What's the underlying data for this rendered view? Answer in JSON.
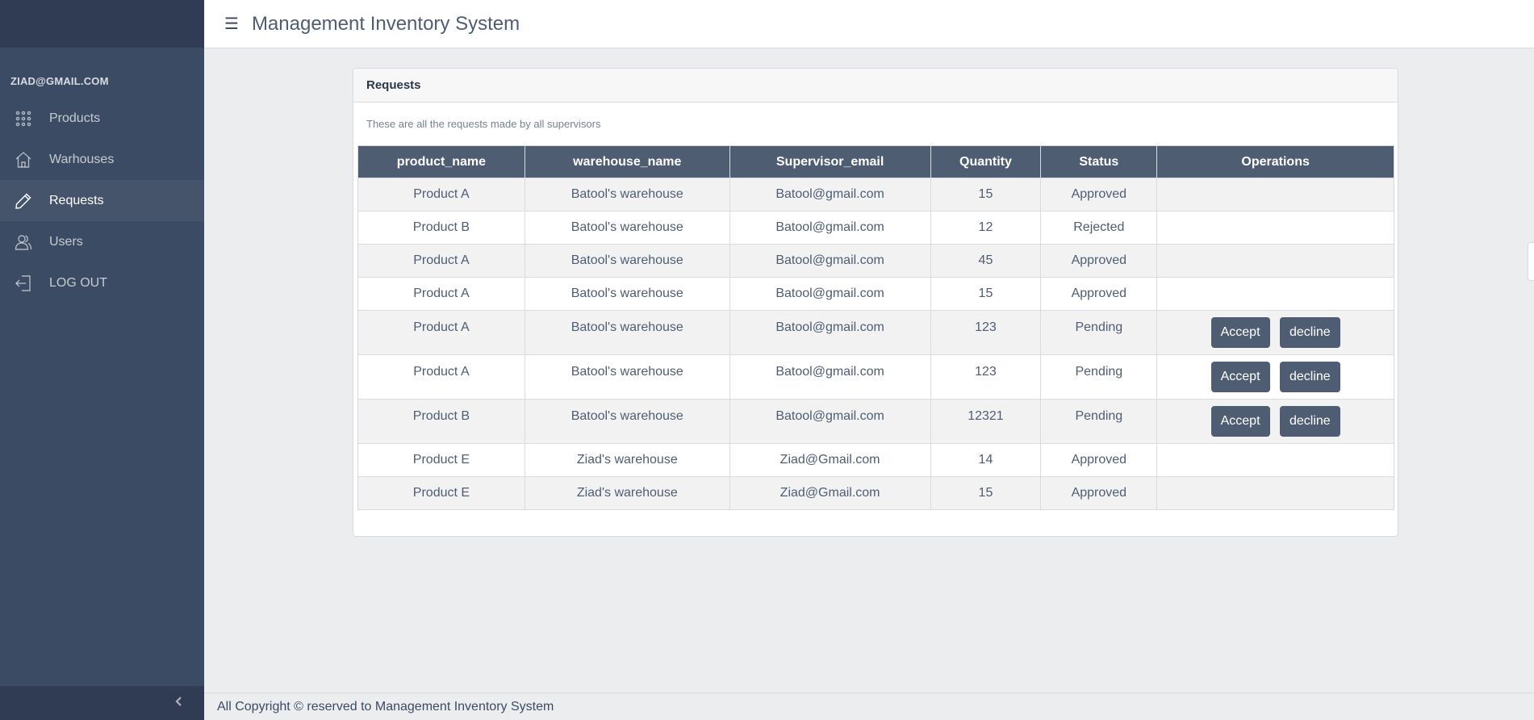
{
  "header": {
    "menu_icon": "hamburger-icon",
    "title": "Management Inventory System"
  },
  "sidebar": {
    "user_email": "ZIAD@GMAIL.COM",
    "items": [
      {
        "label": "Products",
        "icon": "grid-icon",
        "active": false
      },
      {
        "label": "Warhouses",
        "icon": "home-icon",
        "active": false
      },
      {
        "label": "Requests",
        "icon": "pencil-icon",
        "active": true
      },
      {
        "label": "Users",
        "icon": "users-icon",
        "active": false
      },
      {
        "label": "LOG OUT",
        "icon": "logout-icon",
        "active": false
      }
    ],
    "toggler_icon": "chevron-left-icon"
  },
  "card": {
    "title": "Requests",
    "description": "These are all the requests made by all supervisors",
    "columns": [
      "product_name",
      "warehouse_name",
      "Supervisor_email",
      "Quantity",
      "Status",
      "Operations"
    ],
    "rows": [
      {
        "product_name": "Product A",
        "warehouse_name": "Batool's warehouse",
        "supervisor_email": "Batool@gmail.com",
        "quantity": "15",
        "status": "Approved"
      },
      {
        "product_name": "Product B",
        "warehouse_name": "Batool's warehouse",
        "supervisor_email": "Batool@gmail.com",
        "quantity": "12",
        "status": "Rejected"
      },
      {
        "product_name": "Product A",
        "warehouse_name": "Batool's warehouse",
        "supervisor_email": "Batool@gmail.com",
        "quantity": "45",
        "status": "Approved"
      },
      {
        "product_name": "Product A",
        "warehouse_name": "Batool's warehouse",
        "supervisor_email": "Batool@gmail.com",
        "quantity": "15",
        "status": "Approved"
      },
      {
        "product_name": "Product A",
        "warehouse_name": "Batool's warehouse",
        "supervisor_email": "Batool@gmail.com",
        "quantity": "123",
        "status": "Pending"
      },
      {
        "product_name": "Product A",
        "warehouse_name": "Batool's warehouse",
        "supervisor_email": "Batool@gmail.com",
        "quantity": "123",
        "status": "Pending"
      },
      {
        "product_name": "Product B",
        "warehouse_name": "Batool's warehouse",
        "supervisor_email": "Batool@gmail.com",
        "quantity": "12321",
        "status": "Pending"
      },
      {
        "product_name": "Product E",
        "warehouse_name": "Ziad's warehouse",
        "supervisor_email": "Ziad@Gmail.com",
        "quantity": "14",
        "status": "Approved"
      },
      {
        "product_name": "Product E",
        "warehouse_name": "Ziad's warehouse",
        "supervisor_email": "Ziad@Gmail.com",
        "quantity": "15",
        "status": "Approved"
      }
    ],
    "accept_label": "Accept",
    "decline_label": "decline"
  },
  "footer": {
    "text": "All Copyright © reserved to Management Inventory System"
  },
  "colors": {
    "sidebar": "#3c4b64",
    "sidebar_dark": "#303c54",
    "header_row": "#4f5d73",
    "button": "#4f5d73",
    "background": "#ebedef"
  }
}
